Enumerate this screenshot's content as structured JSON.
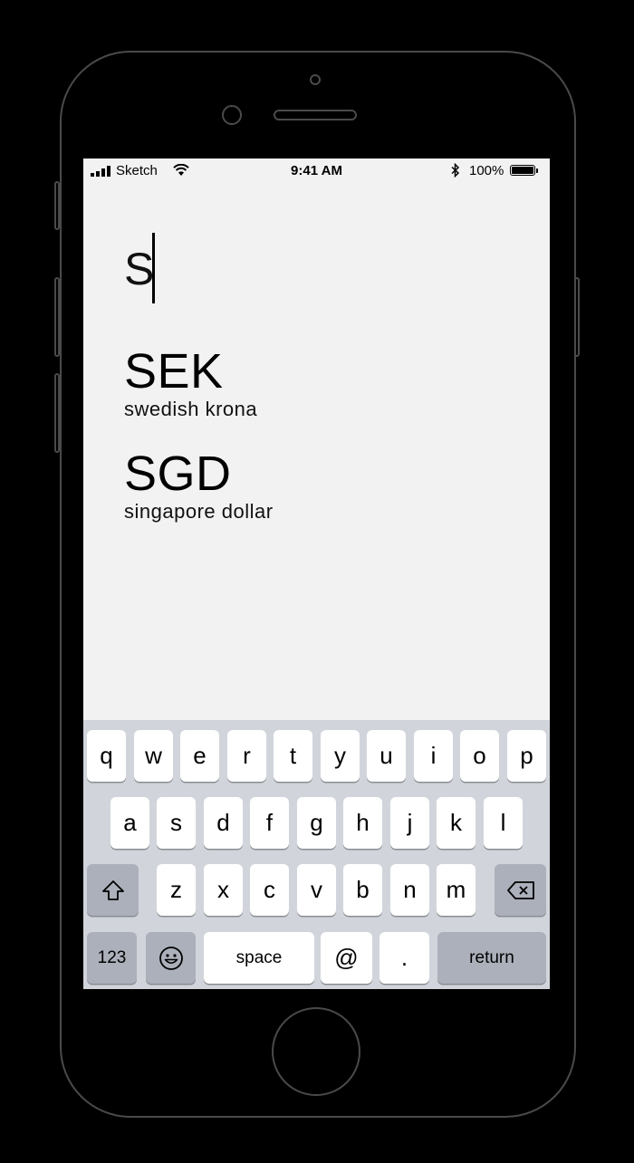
{
  "status": {
    "carrier": "Sketch",
    "time": "9:41 AM",
    "battery": "100%"
  },
  "search": {
    "query": "S"
  },
  "results": [
    {
      "code": "SEK",
      "name": "swedish krona"
    },
    {
      "code": "SGD",
      "name": "singapore dollar"
    }
  ],
  "keyboard": {
    "row1": [
      "q",
      "w",
      "e",
      "r",
      "t",
      "y",
      "u",
      "i",
      "o",
      "p"
    ],
    "row2": [
      "a",
      "s",
      "d",
      "f",
      "g",
      "h",
      "j",
      "k",
      "l"
    ],
    "row3": [
      "z",
      "x",
      "c",
      "v",
      "b",
      "n",
      "m"
    ],
    "numbers_label": "123",
    "space_label": "space",
    "at_label": "@",
    "period_label": ".",
    "return_label": "return"
  }
}
